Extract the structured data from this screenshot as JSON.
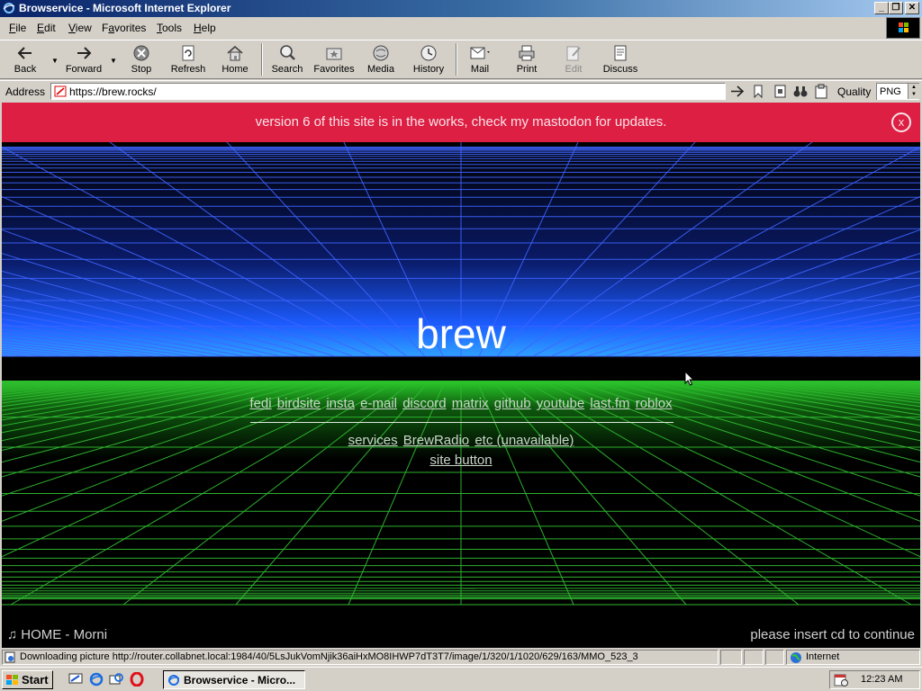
{
  "window": {
    "title": "Browservice - Microsoft Internet Explorer",
    "controls": {
      "minimize": "_",
      "restore": "❐",
      "close": "✕"
    }
  },
  "menu": {
    "items": [
      {
        "label": "File",
        "key": "F",
        "rest": "ile"
      },
      {
        "label": "Edit",
        "key": "E",
        "rest": "dit"
      },
      {
        "label": "View",
        "key": "V",
        "rest": "iew"
      },
      {
        "label": "Favorites",
        "key": "a",
        "pre": "F",
        "rest": "vorites"
      },
      {
        "label": "Tools",
        "key": "T",
        "rest": "ools"
      },
      {
        "label": "Help",
        "key": "H",
        "rest": "elp"
      }
    ]
  },
  "toolbar": {
    "back": "Back",
    "forward": "Forward",
    "stop": "Stop",
    "refresh": "Refresh",
    "home": "Home",
    "search": "Search",
    "favorites": "Favorites",
    "media": "Media",
    "history": "History",
    "mail": "Mail",
    "print": "Print",
    "edit": "Edit",
    "discuss": "Discuss"
  },
  "address": {
    "label": "Address",
    "url": "https://brew.rocks/",
    "quality_label": "Quality",
    "quality_value": "PNG"
  },
  "page": {
    "banner": "version 6 of this site is in the works, check my mastodon for updates.",
    "banner_close": "x",
    "title": "brew",
    "links_primary": [
      "fedi",
      "birdsite",
      "insta",
      "e-mail",
      "discord",
      "matrix",
      "github",
      "youtube",
      "last.fm",
      "roblox"
    ],
    "links_secondary": [
      "services",
      "BrewRadio",
      "etc (unavailable)"
    ],
    "site_button": "site button",
    "player_text": "HOME - Morni",
    "player_icon": "♫",
    "footer_right": "please insert cd to continue",
    "colors": {
      "banner_bg": "#dc1f43",
      "grid_blue": "#3e64ff",
      "grid_green": "#2fb82f",
      "background": "#000000"
    }
  },
  "status": {
    "text": "Downloading picture http://router.collabnet.local:1984/40/5LsJukVomNjik36aiHxMO8IHWP7dT3T7/image/1/320/1/1020/629/163/MMO_523_3",
    "zone": "Internet"
  },
  "taskbar": {
    "start": "Start",
    "task": "Browservice - Micro...",
    "clock": "12:23 AM"
  }
}
